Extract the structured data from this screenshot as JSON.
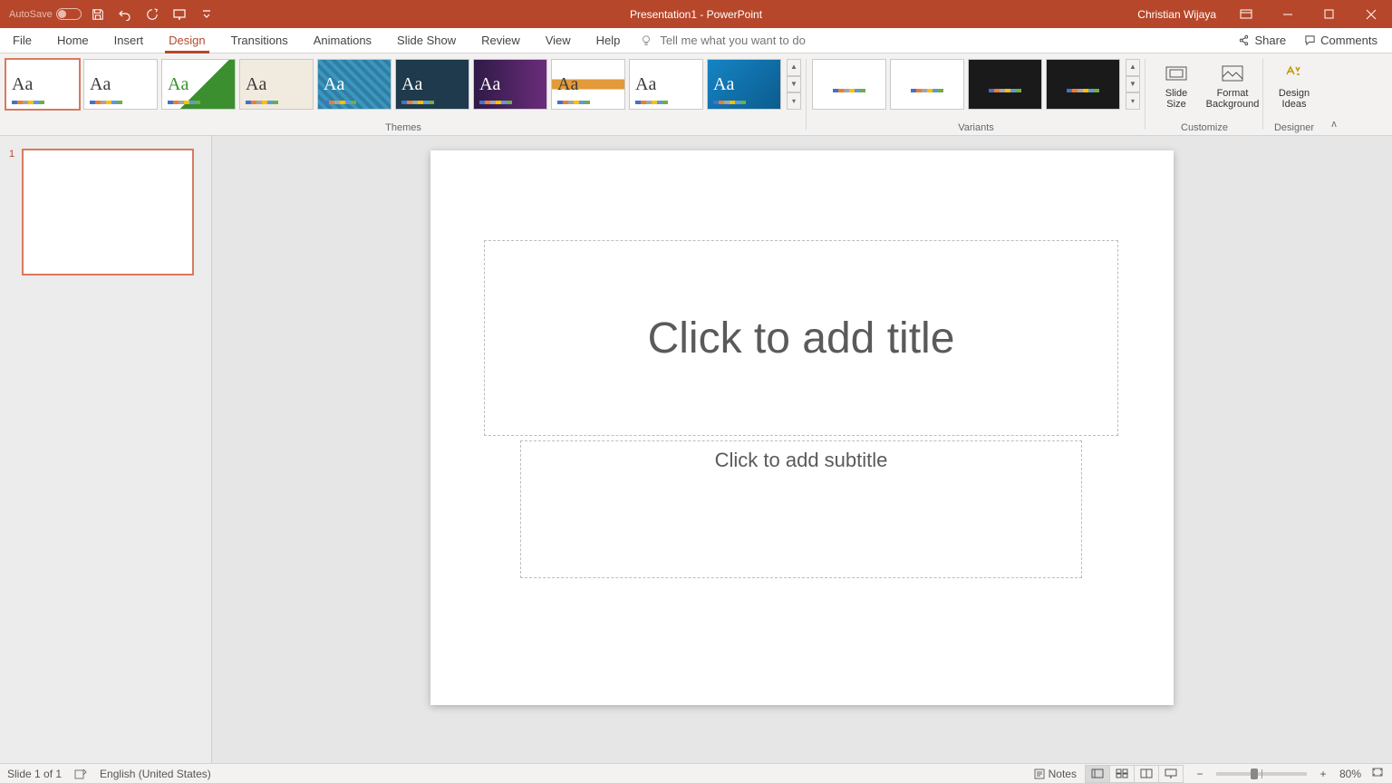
{
  "titlebar": {
    "autosave_label": "AutoSave",
    "title": "Presentation1 - PowerPoint",
    "user": "Christian Wijaya"
  },
  "tabs": {
    "file": "File",
    "home": "Home",
    "insert": "Insert",
    "design": "Design",
    "transitions": "Transitions",
    "animations": "Animations",
    "slideshow": "Slide Show",
    "review": "Review",
    "view": "View",
    "help": "Help",
    "tell_me_placeholder": "Tell me what you want to do",
    "share": "Share",
    "comments": "Comments"
  },
  "ribbon": {
    "active_tab": "design",
    "themes_label": "Themes",
    "variants_label": "Variants",
    "customize_label": "Customize",
    "designer_label": "Designer",
    "slide_size": "Slide\nSize",
    "format_bg": "Format\nBackground",
    "design_ideas": "Design\nIdeas",
    "themes": [
      {
        "aa_color": "#3b3b3b",
        "bg": "#ffffff",
        "border": "selected"
      },
      {
        "aa_color": "#3b3b3b",
        "bg": "#ffffff"
      },
      {
        "aa_color": "#3b8f2f",
        "bg": "linear-gradient(135deg,#ffffff 55%,#3b8f2f 55%)"
      },
      {
        "aa_color": "#3b3b3b",
        "bg": "#f1eade"
      },
      {
        "aa_color": "#ffffff",
        "bg": "repeating-linear-gradient(45deg,#2e7fa3,#2e7fa3 4px,#3c96bf 4px,#3c96bf 8px)"
      },
      {
        "aa_color": "#ffffff",
        "bg": "#1e3a4c"
      },
      {
        "aa_color": "#ffffff",
        "bg": "linear-gradient(90deg,#2e1a47,#6b2c7a)"
      },
      {
        "aa_color": "#3b3b3b",
        "bg": "linear-gradient(#fff 40%,#e39a3a 40%,#e39a3a 60%,#fff 60%)"
      },
      {
        "aa_color": "#3b3b3b",
        "bg": "#ffffff"
      },
      {
        "aa_color": "#ffffff",
        "bg": "linear-gradient(135deg,#1584c4,#0b5c8e)"
      }
    ],
    "variants": [
      {
        "bg": "#ffffff"
      },
      {
        "bg": "#ffffff"
      },
      {
        "bg": "#1a1a1a"
      },
      {
        "bg": "#1a1a1a"
      }
    ],
    "swatch_colors": [
      "#4472c4",
      "#ed7d31",
      "#a5a5a5",
      "#ffc000",
      "#5b9bd5",
      "#70ad47"
    ]
  },
  "slide": {
    "thumb_number": "1",
    "title_placeholder": "Click to add title",
    "subtitle_placeholder": "Click to add subtitle"
  },
  "status": {
    "slide_count": "Slide 1 of 1",
    "language": "English (United States)",
    "notes": "Notes",
    "zoom": "80%"
  }
}
